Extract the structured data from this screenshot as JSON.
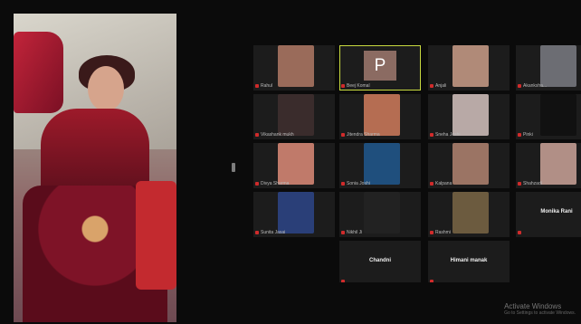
{
  "active_speaker": {
    "icon": "participant-video"
  },
  "participants": [
    {
      "name": "Rahul",
      "video": "#9a6b5a",
      "row": 0,
      "col": 0
    },
    {
      "name": "Beej Komal",
      "video": "avatar",
      "avatar_letter": "P",
      "row": 0,
      "col": 1,
      "active": true
    },
    {
      "name": "Anjali",
      "video": "#b08a78",
      "row": 0,
      "col": 2
    },
    {
      "name": "Akanksha...",
      "video": "#6c6d73",
      "row": 0,
      "col": 3
    },
    {
      "name": "Vikashank mukh",
      "video": "#3a2c2c",
      "row": 1,
      "col": 0
    },
    {
      "name": "Jitendra Sharma",
      "video": "#b56d52",
      "row": 1,
      "col": 1
    },
    {
      "name": "Sneha Joshi",
      "video": "#b8a9a6",
      "row": 1,
      "col": 2
    },
    {
      "name": "Pinki",
      "video": "#111111",
      "row": 1,
      "col": 3
    },
    {
      "name": "Divya Sharma",
      "video": "#c07a6a",
      "row": 2,
      "col": 0
    },
    {
      "name": "Sonia Joshi",
      "video": "#1f4f7d",
      "row": 2,
      "col": 1
    },
    {
      "name": "Kalpana",
      "video": "#9b7464",
      "row": 2,
      "col": 2
    },
    {
      "name": "Shahzadi",
      "video": "#b18f86",
      "row": 2,
      "col": 3
    },
    {
      "name": "Sunita Jasai",
      "video": "#2a3f78",
      "row": 3,
      "col": 0
    },
    {
      "name": "Nikhil Ji",
      "video": "#222222",
      "row": 3,
      "col": 1
    },
    {
      "name": "Rashmi",
      "video": "#6c5b3f",
      "row": 3,
      "col": 2
    },
    {
      "name": "Monika Rani",
      "video": "none",
      "row": 3,
      "col": 3
    },
    {
      "name": "Chandni",
      "video": "none",
      "row": 4,
      "col": 1
    },
    {
      "name": "Himani manak",
      "video": "none",
      "row": 4,
      "col": 2
    }
  ],
  "watermark": {
    "title": "Activate Windows",
    "subtitle": "Go to Settings to activate Windows."
  },
  "colors": {
    "background": "#0b0b0b",
    "tile": "#1c1c1c",
    "active_border": "#c9da3f",
    "mic_muted": "#d02b2b"
  }
}
